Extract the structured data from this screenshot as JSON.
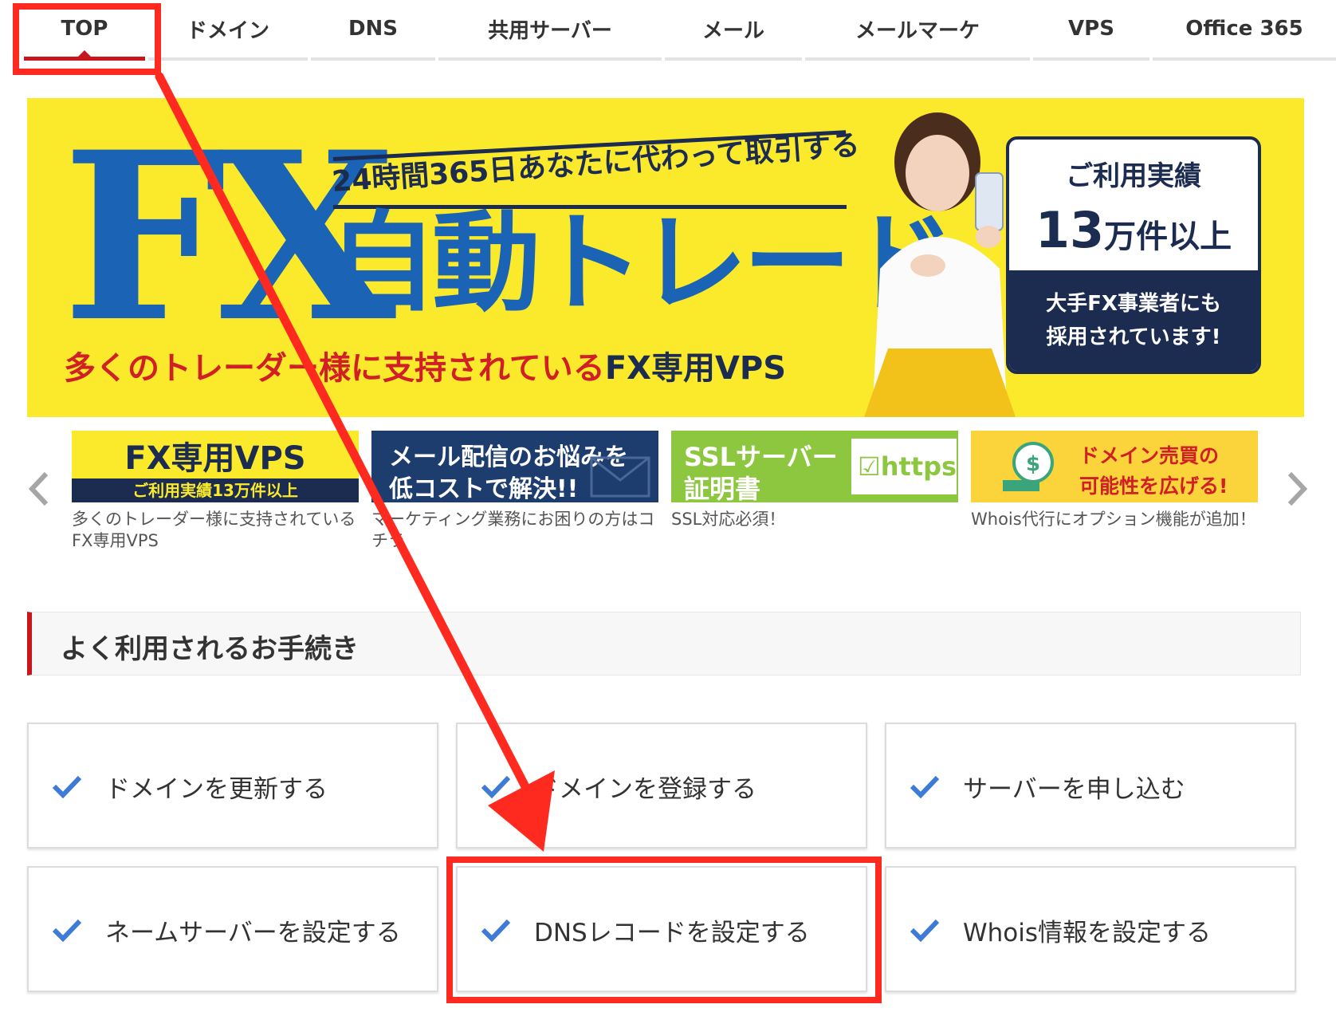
{
  "nav": {
    "items": [
      {
        "label": "TOP",
        "active": true
      },
      {
        "label": "ドメイン"
      },
      {
        "label": "DNS"
      },
      {
        "label": "共用サーバー"
      },
      {
        "label": "メール"
      },
      {
        "label": "メールマーケ"
      },
      {
        "label": "VPS"
      },
      {
        "label": "Office 365"
      }
    ],
    "active_color": "#c8161d"
  },
  "hero": {
    "logo": "FX",
    "tagline": "24時間365日あなたに代わって取引する",
    "title": "自動トレード",
    "subtitle_red": "多くのトレーダー様に支持されている",
    "subtitle_dark": "FX専用VPS",
    "badge": {
      "line1": "ご利用実績",
      "line2_big": "13",
      "line2_rest": "万件以上",
      "line3": "大手FX事業者にも",
      "line4": "採用されています!"
    },
    "colors": {
      "background": "#fbea2b",
      "blue": "#1b63b5",
      "navy": "#1c2b50",
      "red": "#d02026"
    }
  },
  "carousel": {
    "prev_icon": "chevron-left-icon",
    "next_icon": "chevron-right-icon",
    "cards": [
      {
        "banner_line1": "FX専用VPS",
        "banner_line2": "ご利用実績13万件以上",
        "caption": "多くのトレーダー様に支持されているFX専用VPS"
      },
      {
        "banner_line1": "メール配信のお悩みを",
        "banner_line2": "低コストで解決!!",
        "caption": "マーケティング業務にお困りの方はコチラ"
      },
      {
        "banner_line1": "SSLサーバー",
        "banner_line2": "証明書",
        "banner_box": "https:",
        "caption": "SSL対応必須！"
      },
      {
        "banner_line1": "ドメイン売買の",
        "banner_line2": "可能性を広げる!",
        "caption": "Whois代行にオプション機能が追加！"
      }
    ]
  },
  "section": {
    "title": "よく利用されるお手続き"
  },
  "procedures": [
    {
      "label": "ドメインを更新する"
    },
    {
      "label": "ドメインを登録する"
    },
    {
      "label": "サーバーを申し込む"
    },
    {
      "label": "ネームサーバーを設定する"
    },
    {
      "label": "DNSレコードを設定する",
      "highlighted": true
    },
    {
      "label": "Whois情報を設定する"
    }
  ],
  "annotation_color": "#ff2a1f"
}
